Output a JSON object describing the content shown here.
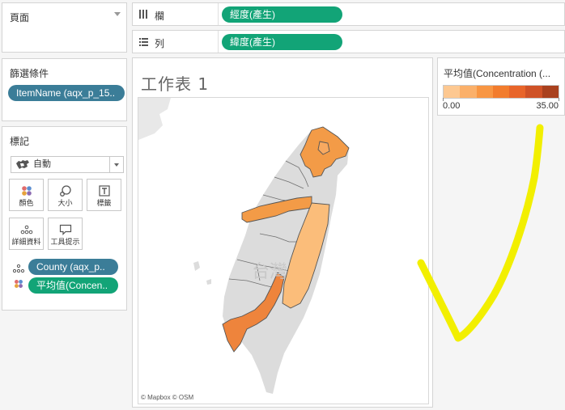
{
  "pages": {
    "title": "頁面"
  },
  "filters": {
    "title": "篩選條件",
    "pill": "ItemName (aqx_p_15.."
  },
  "marks": {
    "title": "標記",
    "mark_type": {
      "label": "自動",
      "icon": "map-icon"
    },
    "buttons": [
      {
        "label": "顏色",
        "icon": "color-dots-icon"
      },
      {
        "label": "大小",
        "icon": "size-icon"
      },
      {
        "label": "標籤",
        "icon": "label-icon"
      },
      {
        "label": "詳細資料",
        "icon": "detail-icon"
      },
      {
        "label": "工具提示",
        "icon": "tooltip-icon"
      }
    ],
    "fields": [
      {
        "label": "County (aqx_p..",
        "type": "detail",
        "color": "#3b7d98"
      },
      {
        "label": "平均值(Concen..",
        "type": "color",
        "color": "#12a477"
      }
    ]
  },
  "shelves": {
    "columns": {
      "label": "欄",
      "pill": "經度(產生)"
    },
    "rows": {
      "label": "列",
      "pill": "緯度(產生)"
    }
  },
  "sheet": {
    "title": "工作表 1"
  },
  "map": {
    "attribution": "© Mapbox © OSM",
    "watermark": "台灣"
  },
  "legend": {
    "title": "平均值(Concentration (...",
    "min": "0.00",
    "max": "35.00",
    "colors": [
      "#fdc891",
      "#fbb06a",
      "#f89643",
      "#f27c2d",
      "#e8652a",
      "#cf5227",
      "#a9411e"
    ]
  },
  "colors": {
    "accent_green": "#12a477",
    "accent_blue": "#3b7d98",
    "annotation": "#f2ef00"
  }
}
